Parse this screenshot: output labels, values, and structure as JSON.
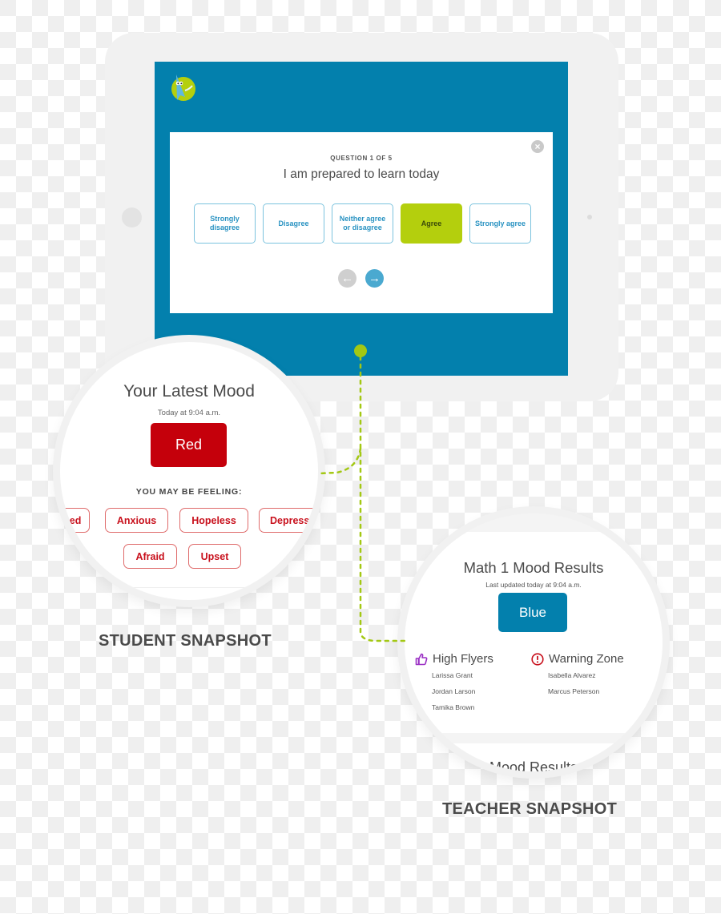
{
  "tablet": {
    "logo_icon": "mascot-arrow-logo",
    "survey": {
      "counter": "QUESTION 1 OF 5",
      "question": "I am prepared to learn today",
      "close_icon": "close-circle-icon",
      "answers": [
        {
          "label": "Strongly disagree",
          "selected": false
        },
        {
          "label": "Disagree",
          "selected": false
        },
        {
          "label": "Neither agree or disagree",
          "selected": false
        },
        {
          "label": "Agree",
          "selected": true
        },
        {
          "label": "Strongly agree",
          "selected": false
        }
      ],
      "prev_icon": "arrow-left-circle-icon",
      "next_icon": "arrow-right-circle-icon"
    }
  },
  "student": {
    "title": "Your Latest Mood",
    "timestamp": "Today at 9:04 a.m.",
    "mood": "Red",
    "feeling_heading": "YOU MAY BE FEELING:",
    "feelings_row1": [
      "Discouraged",
      "Anxious",
      "Hopeless",
      "Depressed"
    ],
    "feelings_row2": [
      "Afraid",
      "Upset"
    ],
    "label": "STUDENT SNAPSHOT"
  },
  "teacher": {
    "title": "Math 1 Mood Results",
    "timestamp": "Last updated today at 9:04 a.m.",
    "mood": "Blue",
    "high_flyers": {
      "title": "High Flyers",
      "icon": "thumbs-up-icon",
      "students": [
        "Larissa Grant",
        "Jordan Larson",
        "Tamika Brown"
      ]
    },
    "warning_zone": {
      "title": "Warning Zone",
      "icon": "exclamation-circle-icon",
      "students": [
        "Isabella Alvarez",
        "Marcus Peterson"
      ]
    },
    "next_card_partial": "Mood Results",
    "label": "TEACHER SNAPSHOT"
  },
  "colors": {
    "screen_blue": "#0380ad",
    "accent_green": "#b4cf0d",
    "mood_red": "#c5000b",
    "mood_blue": "#0380ad",
    "answer_text": "#2a93c2",
    "high_flyer_purple": "#9a2fc4",
    "warning_red": "#c8101c"
  }
}
